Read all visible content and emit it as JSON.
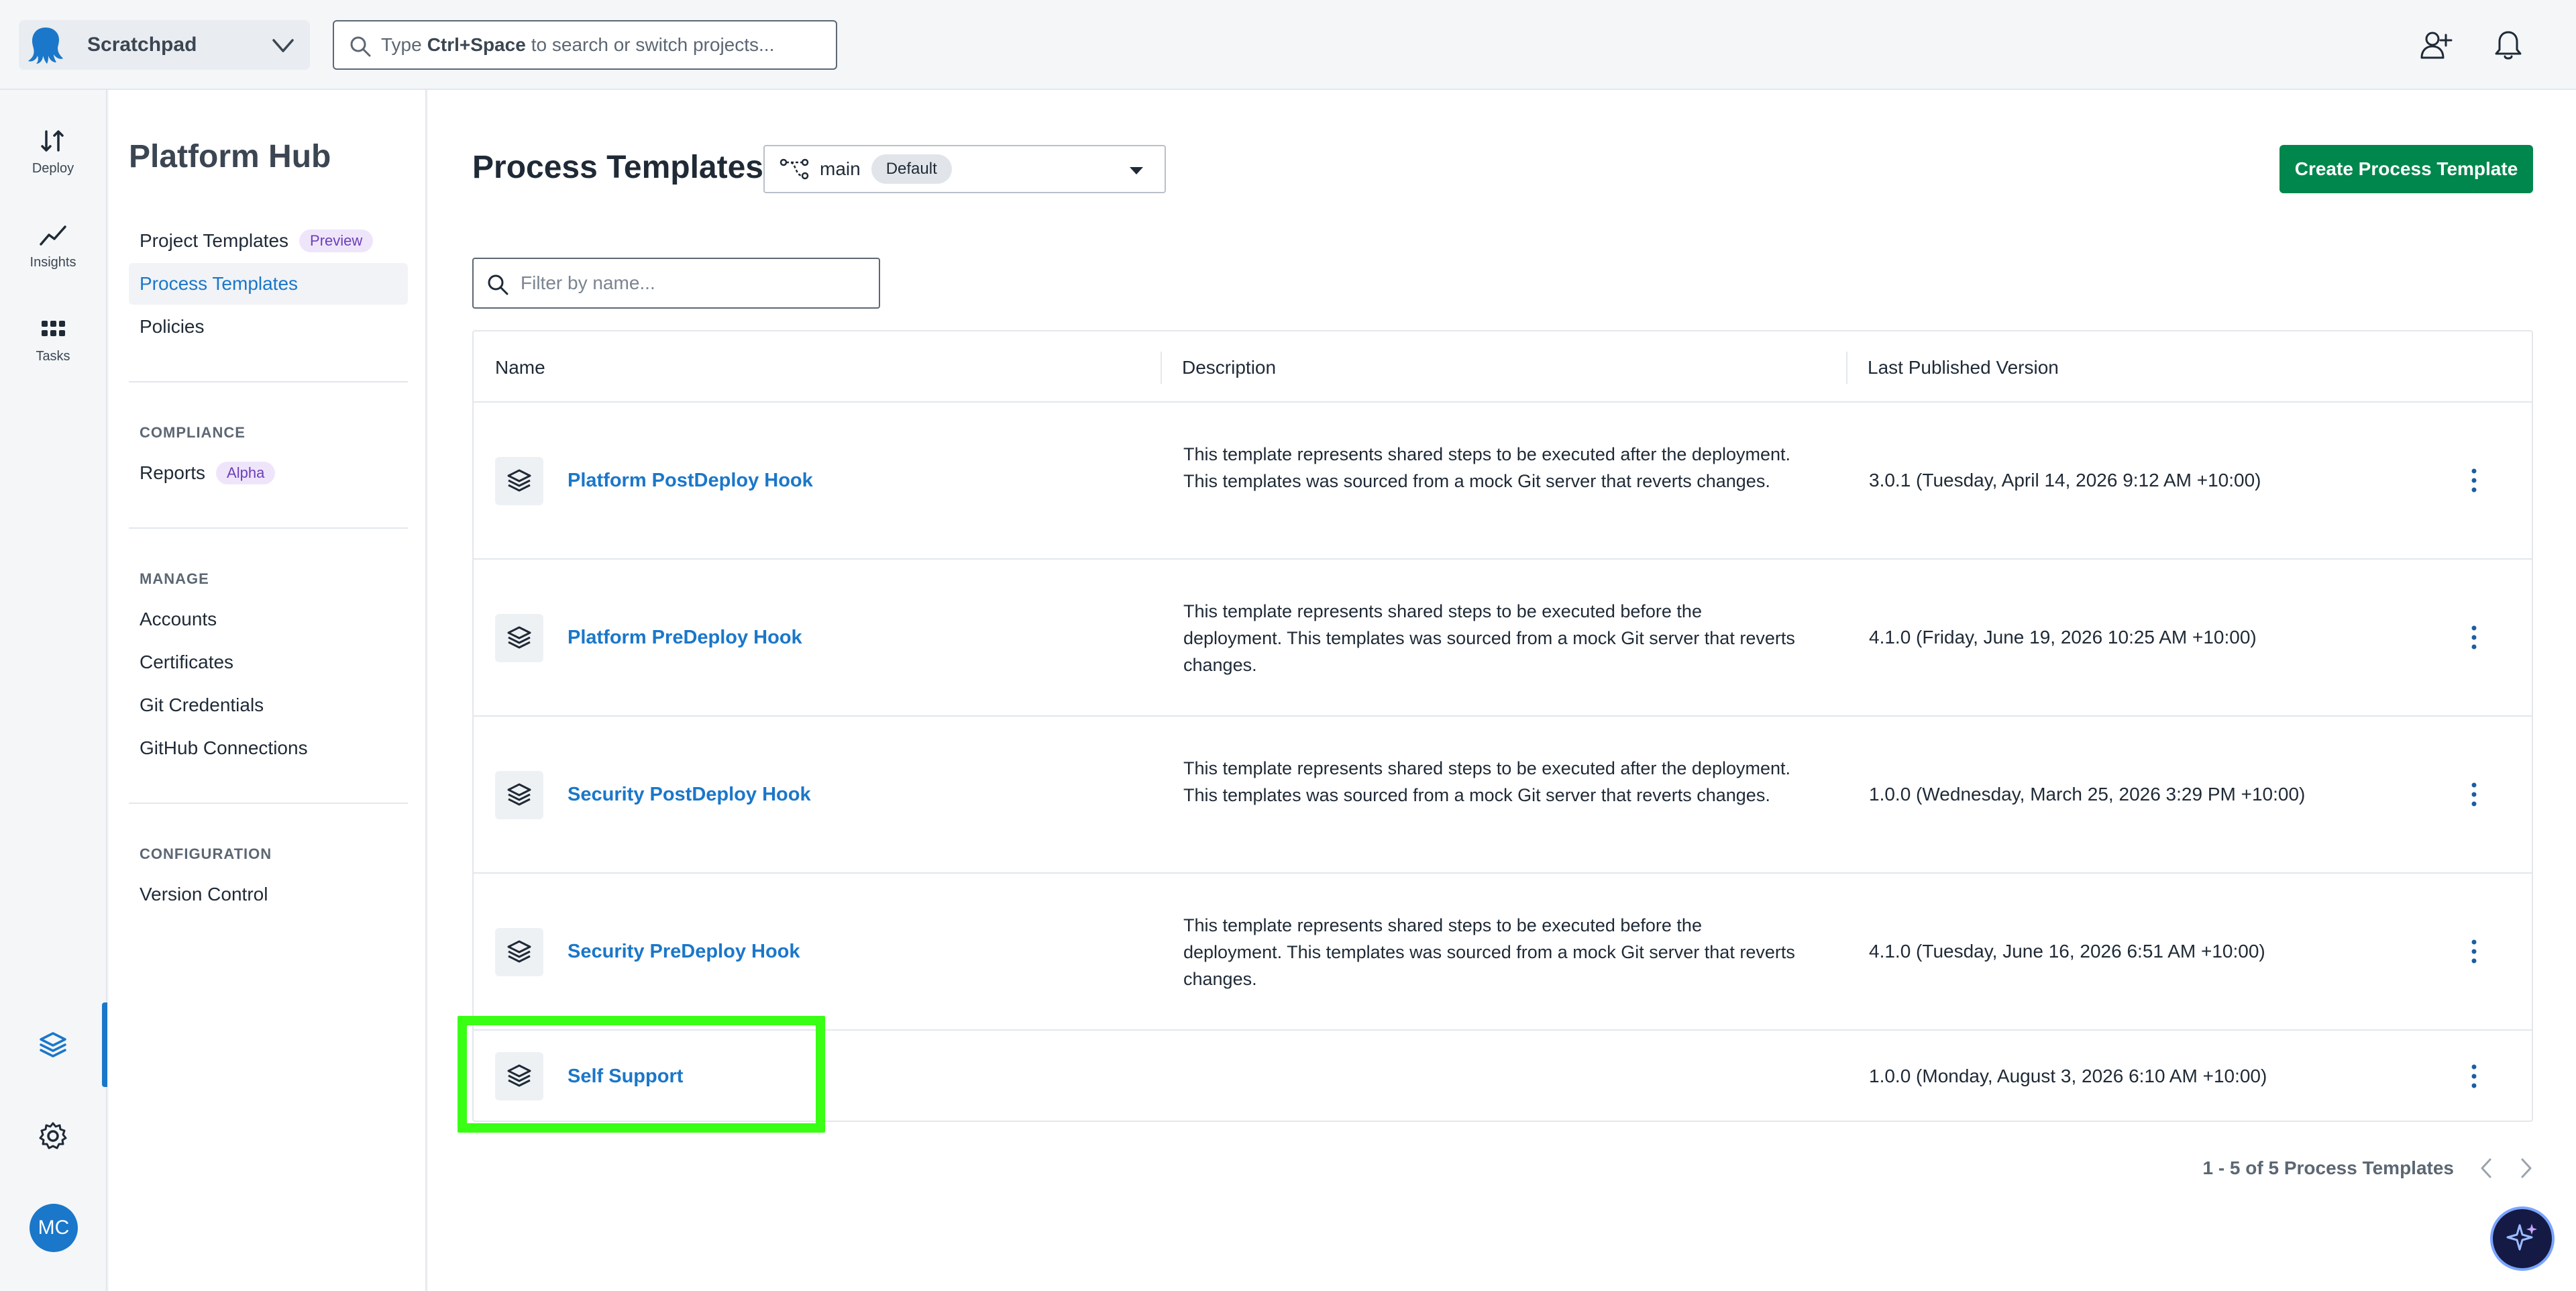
{
  "topbar": {
    "space_name": "Scratchpad",
    "search": {
      "prefix": "Type",
      "shortcut": "Ctrl+Space",
      "suffix": "to search or switch projects..."
    }
  },
  "rail": {
    "items": [
      {
        "label": "Deploy",
        "icon": "deploy-icon"
      },
      {
        "label": "Insights",
        "icon": "insights-icon"
      },
      {
        "label": "Tasks",
        "icon": "tasks-icon"
      }
    ],
    "avatar_initials": "MC",
    "accent": "#1a77ca"
  },
  "subnav": {
    "title": "Platform Hub",
    "primary": [
      {
        "label": "Project Templates",
        "badge": "Preview"
      },
      {
        "label": "Process Templates"
      },
      {
        "label": "Policies"
      }
    ],
    "compliance": {
      "heading": "COMPLIANCE",
      "items": [
        {
          "label": "Reports",
          "badge": "Alpha"
        }
      ]
    },
    "manage": {
      "heading": "MANAGE",
      "items": [
        {
          "label": "Accounts"
        },
        {
          "label": "Certificates"
        },
        {
          "label": "Git Credentials"
        },
        {
          "label": "GitHub Connections"
        }
      ]
    },
    "configuration": {
      "heading": "CONFIGURATION",
      "items": [
        {
          "label": "Version Control"
        }
      ]
    }
  },
  "main": {
    "title": "Process Templates",
    "branch": {
      "name": "main",
      "badge": "Default"
    },
    "create_label": "Create Process Template",
    "filter_placeholder": "Filter by name...",
    "columns": [
      "Name",
      "Description",
      "Last Published Version"
    ],
    "rows": [
      {
        "name": "Platform PostDeploy Hook",
        "description": "This template represents shared steps to be executed after the deployment. This templates was sourced from a mock Git server that reverts changes.",
        "version": "3.0.1 (Tuesday, April 14, 2026 9:12 AM +10:00)"
      },
      {
        "name": "Platform PreDeploy Hook",
        "description": "This template represents shared steps to be executed before the deployment. This templates was sourced from a mock Git server that reverts changes.",
        "version": "4.1.0 (Friday, June 19, 2026 10:25 AM +10:00)"
      },
      {
        "name": "Security PostDeploy Hook",
        "description": "This template represents shared steps to be executed after the deployment. This templates was sourced from a mock Git server that reverts changes.",
        "version": "1.0.0 (Wednesday, March 25, 2026 3:29 PM +10:00)"
      },
      {
        "name": "Security PreDeploy Hook",
        "description": "This template represents shared steps to be executed before the deployment. This templates was sourced from a mock Git server that reverts changes.",
        "version": "4.1.0 (Tuesday, June 16, 2026 6:51 AM +10:00)"
      },
      {
        "name": "Self Support",
        "description": "",
        "version": "1.0.0 (Monday, August 3, 2026 6:10 AM +10:00)"
      }
    ],
    "pagination": "1 - 5 of 5 Process Templates"
  },
  "colors": {
    "link": "#1a77ca",
    "primary_button": "#00874d",
    "highlight": "#39ff14",
    "badge_bg": "#efe5fb",
    "badge_text": "#6b3fb8"
  }
}
